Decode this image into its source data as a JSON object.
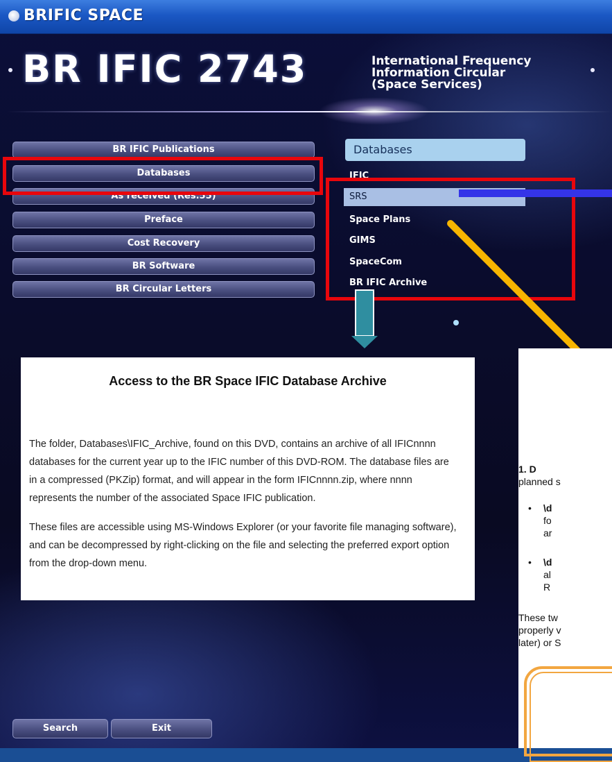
{
  "window": {
    "title": "BRIFIC SPACE"
  },
  "banner": {
    "title": "BR IFIC 2743",
    "subtitle_lines": [
      "International Frequency",
      "Information Circular",
      "(Space Services)"
    ]
  },
  "menu": {
    "items": [
      {
        "label": "BR IFIC Publications"
      },
      {
        "label": "Databases"
      },
      {
        "label": "As received (Res.55)"
      },
      {
        "label": "Preface"
      },
      {
        "label": "Cost Recovery"
      },
      {
        "label": "BR Software"
      },
      {
        "label": "BR Circular Letters"
      }
    ],
    "selected": "Databases"
  },
  "submenu": {
    "header": "Databases",
    "items": [
      {
        "label": "IFIC"
      },
      {
        "label": "SRS"
      },
      {
        "label": "Space Plans"
      },
      {
        "label": "GIMS"
      },
      {
        "label": "SpaceCom"
      },
      {
        "label": "BR IFIC Archive"
      }
    ],
    "selected": "SRS"
  },
  "info_panel": {
    "title": "Access to the BR Space IFIC Database Archive",
    "paragraph1_lines": [
      "The folder, Databases\\IFIC_Archive, found on this DVD, contains an archive of all IFICnnnn",
      "databases for the current year up to the IFIC number of this DVD-ROM.  The database files are",
      "in a compressed (PKZip) format, and will appear in the form IFICnnnn.zip, where nnnn",
      "represents the number of the associated Space IFIC publication."
    ],
    "paragraph2_lines": [
      "These files are accessible using MS-Windows Explorer (or your favorite file managing software),",
      "and can be decompressed by right-clicking on the file and selecting the preferred export option",
      "from the drop-down menu."
    ]
  },
  "right_doc": {
    "lines": [
      "1.        D",
      "planned s",
      "\\d",
      "fo",
      "ar",
      "\\d",
      "al",
      "R",
      "These tw",
      "properly v",
      "later) or S"
    ]
  },
  "bottom_bar": {
    "search_label": "Search",
    "exit_label": "Exit"
  },
  "colors": {
    "highlight_box": "#e8060c",
    "blue_arrow": "#3434e8",
    "yellow_arrow": "#f7b500",
    "teal_arrow": "#2f8ea0"
  }
}
